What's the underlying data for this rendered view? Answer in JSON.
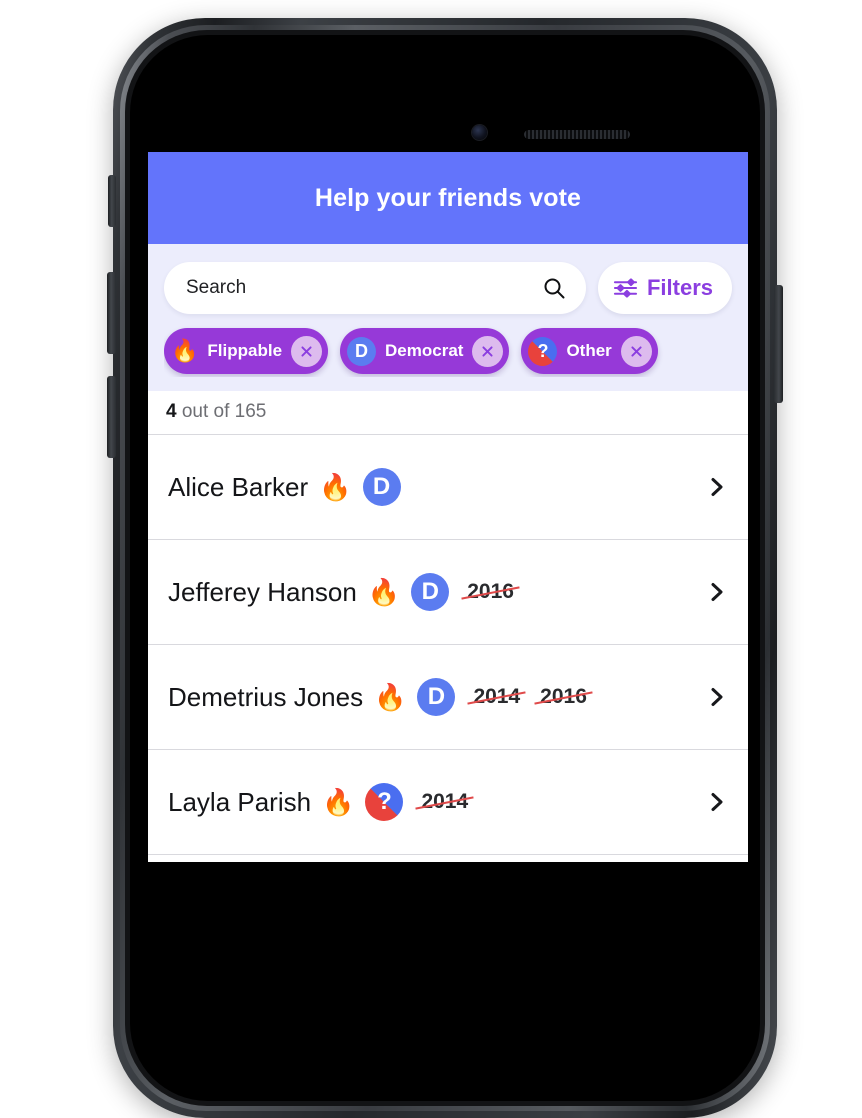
{
  "app": {
    "header": {
      "title": "Help your friends vote",
      "bg_color": "#6374FB"
    },
    "search": {
      "placeholder": "Search",
      "value": "",
      "icon": "search-icon"
    },
    "filters_button": {
      "label": "Filters",
      "icon": "sliders-icon",
      "color": "#8B3EE0"
    },
    "chips": [
      {
        "id": "flippable",
        "label": "Flippable",
        "icon": "fire-emoji",
        "glyph": "🔥",
        "close_label": "×",
        "bg": "#9639D8"
      },
      {
        "id": "democrat",
        "label": "Democrat",
        "icon": "democrat-badge",
        "glyph": "D",
        "close_label": "×",
        "bg": "#9639D8"
      },
      {
        "id": "other",
        "label": "Other",
        "icon": "other-badge",
        "glyph": "?",
        "close_label": "×",
        "bg": "#9639D8"
      }
    ],
    "count": {
      "current": "4",
      "suffix": " out of 165"
    },
    "list": [
      {
        "name": "Alice Barker",
        "fire": "🔥",
        "party": "D",
        "party_type": "democrat",
        "years": [],
        "chevron": "chevron-right-icon"
      },
      {
        "name": "Jefferey Hanson",
        "fire": "🔥",
        "party": "D",
        "party_type": "democrat",
        "years": [
          "2016"
        ],
        "chevron": "chevron-right-icon"
      },
      {
        "name": "Demetrius Jones",
        "fire": "🔥",
        "party": "D",
        "party_type": "democrat",
        "years": [
          "2014",
          "2016"
        ],
        "chevron": "chevron-right-icon"
      },
      {
        "name": "Layla Parish",
        "fire": "🔥",
        "party": "?",
        "party_type": "other",
        "years": [
          "2014"
        ],
        "chevron": "chevron-right-icon"
      }
    ]
  },
  "device": {
    "frame": "iphone-frame",
    "hardware": [
      "mute-switch",
      "volume-up-button",
      "volume-down-button",
      "power-button",
      "front-camera",
      "earpiece-speaker"
    ]
  }
}
